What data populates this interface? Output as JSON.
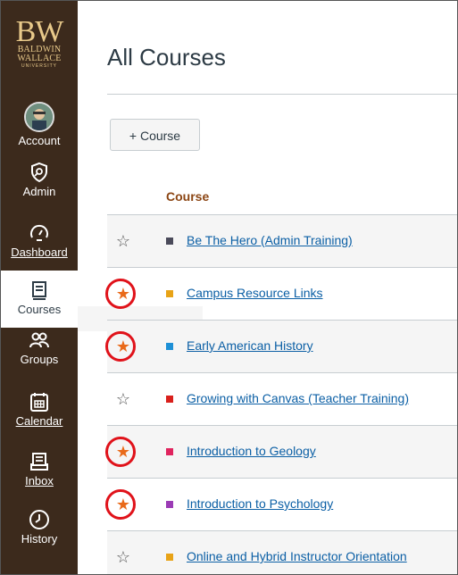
{
  "logo": {
    "big": "BW",
    "line1": "BALDWIN",
    "line2": "WALLACE",
    "line3": "UNIVERSITY"
  },
  "nav": [
    {
      "label": "Account",
      "icon": "avatar-icon"
    },
    {
      "label": "Admin",
      "icon": "shield-icon"
    },
    {
      "label": "Dashboard",
      "icon": "speedometer-icon"
    },
    {
      "label": "Courses",
      "icon": "book-icon"
    },
    {
      "label": "Groups",
      "icon": "people-icon"
    },
    {
      "label": "Calendar",
      "icon": "calendar-icon"
    },
    {
      "label": "Inbox",
      "icon": "inbox-icon"
    },
    {
      "label": "History",
      "icon": "clock-icon"
    }
  ],
  "page": {
    "title": "All Courses",
    "add_button": "+ Course",
    "column_header": "Course"
  },
  "courses": [
    {
      "name": "Be The Hero (Admin Training)",
      "favorite": false,
      "color": "#4a4a5a"
    },
    {
      "name": "Campus Resource Links",
      "favorite": true,
      "color": "#e8a317"
    },
    {
      "name": "Early American History",
      "favorite": true,
      "color": "#1e90d6"
    },
    {
      "name": "Growing with Canvas (Teacher Training)",
      "favorite": false,
      "color": "#d9201c"
    },
    {
      "name": "Introduction to Geology",
      "favorite": true,
      "color": "#e0245e"
    },
    {
      "name": "Introduction to Psychology",
      "favorite": true,
      "color": "#9b3bb5"
    },
    {
      "name": "Online and Hybrid Instructor Orientation",
      "favorite": false,
      "color": "#e8a317"
    }
  ],
  "star_glyphs": {
    "empty": "☆",
    "filled": "★"
  }
}
